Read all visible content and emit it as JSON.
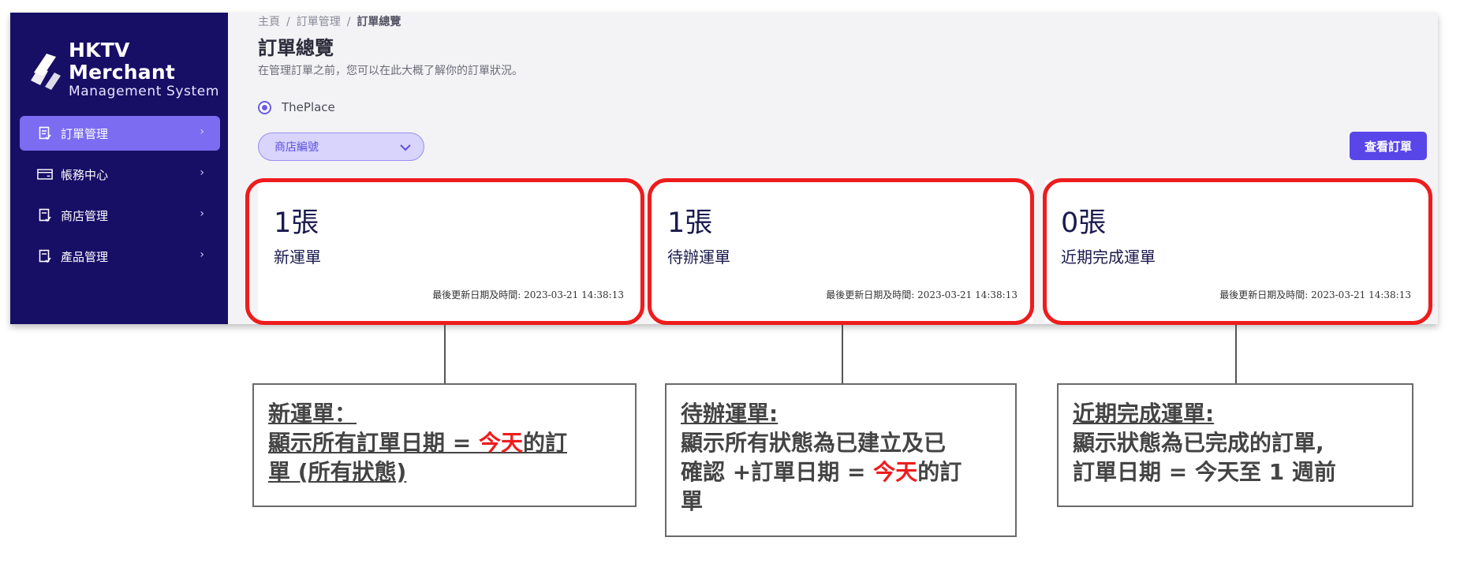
{
  "app": {
    "logo_title": "HKTV Merchant",
    "logo_subtitle": "Management System",
    "brand_color": "#170e66",
    "accent_color": "#5846e8"
  },
  "sidebar": {
    "items": [
      {
        "label": "訂單管理",
        "icon": "order-icon",
        "active": true
      },
      {
        "label": "帳務中心",
        "icon": "billing-icon",
        "active": false
      },
      {
        "label": "商店管理",
        "icon": "store-icon",
        "active": false
      },
      {
        "label": "產品管理",
        "icon": "product-icon",
        "active": false
      }
    ]
  },
  "breadcrumb": {
    "items": [
      "主頁",
      "訂單管理",
      "訂單總覽"
    ],
    "separator": "/"
  },
  "page": {
    "title": "訂單總覽",
    "subtitle": "在管理訂單之前，您可以在此大概了解你的訂單狀況。"
  },
  "filters": {
    "platform_option": "ThePlace",
    "store_select_placeholder": "商店編號",
    "view_orders_button": "查看訂單"
  },
  "cards": [
    {
      "count": "1張",
      "label": "新運單",
      "updated": "最後更新日期及時間: 2023-03-21 14:38:13"
    },
    {
      "count": "1張",
      "label": "待辦運單",
      "updated": "最後更新日期及時間: 2023-03-21 14:38:13"
    },
    {
      "count": "0張",
      "label": "近期完成運單",
      "updated": "最後更新日期及時間: 2023-03-21 14:38:13"
    }
  ],
  "highlight_color": "#ee1c1c",
  "notes": [
    {
      "title": "新運單：",
      "line1_pre": "顯示所有訂單日期 = ",
      "line1_red": "今天",
      "line1_post": "的訂",
      "line2": "單 (所有狀態)"
    },
    {
      "title": "待辦運單:",
      "line1": "顯示所有狀態為已建立及已",
      "line2_pre": "確認 +訂單日期 = ",
      "line2_red": "今天",
      "line2_post": "的訂",
      "line3": "單"
    },
    {
      "title": "近期完成運單:",
      "line1": "顯示狀態為已完成的訂單,",
      "line2": "訂單日期 = 今天至 1 週前"
    }
  ]
}
